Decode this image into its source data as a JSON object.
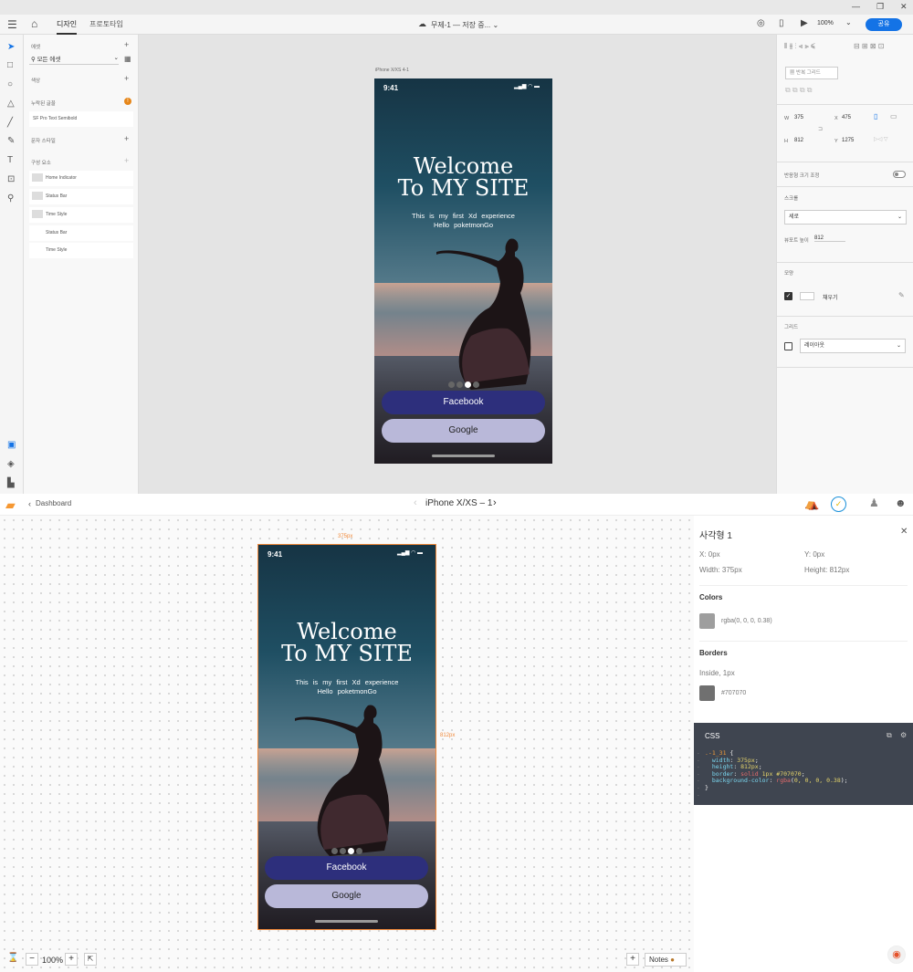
{
  "xd": {
    "window_controls": [
      "—",
      "❐",
      "✕"
    ],
    "tabs": [
      "디자인",
      "프로토타입"
    ],
    "document_title": "무제-1 — 저장 중... ⌄",
    "zoom": "100%",
    "share_label": "공유",
    "left_panel": {
      "assets_label": "에셋",
      "search_value": "모든 에셋",
      "colors_label": "색상",
      "char_styles_label": "누락된 글꼴",
      "font_item": "SF Pro Text Semibold",
      "text_styles_label": "문자 스타일",
      "components_label": "구성 요소",
      "components": [
        "Home Indicator",
        "Status Bar",
        "Time Style",
        "Status Bar",
        "Time Style"
      ]
    },
    "artboard_label": "iPhone X/XS 4-1",
    "right_panel": {
      "repeat_grid_label": "반복 그리드",
      "w_label": "W",
      "w_value": "375",
      "x_label": "X",
      "x_value": "475",
      "h_label": "H",
      "h_value": "812",
      "y_label": "Y",
      "y_value": "1275",
      "responsive_label": "반응형 크기 조정",
      "scroll_label": "스크롤",
      "scroll_value": "세로",
      "viewport_label": "뷰포트 높이",
      "viewport_value": "812",
      "appearance_label": "모양",
      "fill_label": "채우기",
      "grid_label": "그리드",
      "grid_value": "레이아웃"
    }
  },
  "phone": {
    "time": "9:41",
    "status_icons": "▂▄▆ ◠ ▬",
    "welcome_line1": "Welcome",
    "welcome_line2": "To MY SITE",
    "sub_line1": "This is my first Xd experience",
    "sub_line2": "Hello poketmonGo",
    "facebook": "Facebook",
    "google": "Google",
    "dots_count": 4,
    "active_dot": 2
  },
  "zeplin": {
    "back_label": "Dashboard",
    "screen_title": "iPhone X/XS – 1",
    "width_dim": "375px",
    "height_dim": "812px",
    "zoom": "100%",
    "notes": "Notes",
    "inspector": {
      "title": "사각형 1",
      "x": "X:  0px",
      "y": "Y:  0px",
      "width": "Width:  375px",
      "height": "Height:  812px",
      "colors_label": "Colors",
      "color_value": "rgba(0, 0, 0, 0.38)",
      "borders_label": "Borders",
      "border_desc": "Inside, 1px",
      "border_color": "#707070",
      "css_label": "CSS"
    }
  },
  "colors": {
    "accent": "#1473e6",
    "facebook_btn": "#2d2f7c",
    "google_btn": "#b9b8d9",
    "selection": "#f08a3c",
    "css_bg": "#3f4550"
  }
}
